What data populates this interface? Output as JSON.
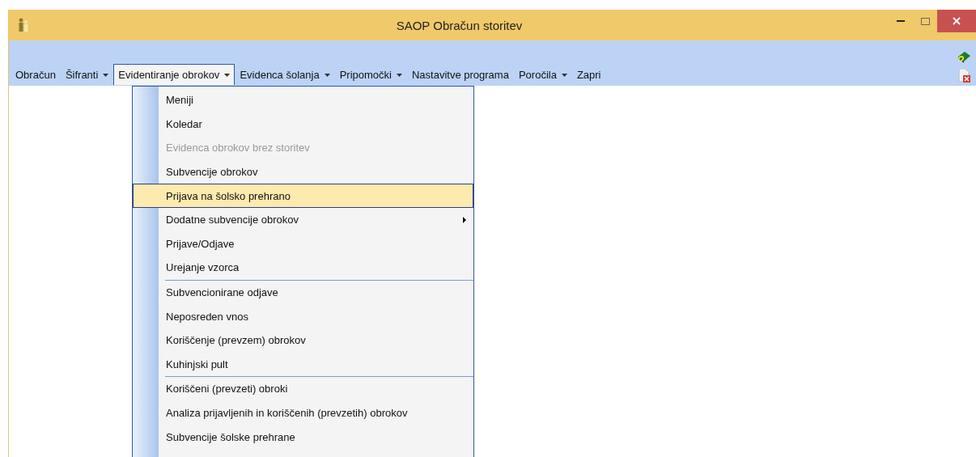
{
  "window": {
    "title": "SAOP Obračun storitev"
  },
  "menubar": [
    {
      "label": "Obračun",
      "dropdown": false,
      "selected": false
    },
    {
      "label": "Šifranti",
      "dropdown": true,
      "selected": false
    },
    {
      "label": "Evidentiranje obrokov",
      "dropdown": true,
      "selected": true
    },
    {
      "label": "Evidenca šolanja",
      "dropdown": true,
      "selected": false
    },
    {
      "label": "Pripomočki",
      "dropdown": true,
      "selected": false
    },
    {
      "label": "Nastavitve programa",
      "dropdown": false,
      "selected": false
    },
    {
      "label": "Poročila",
      "dropdown": true,
      "selected": false
    },
    {
      "label": "Zapri",
      "dropdown": false,
      "selected": false
    }
  ],
  "menu": {
    "groups": [
      [
        {
          "label": "Meniji",
          "disabled": false,
          "selected": false,
          "submenu": false
        },
        {
          "label": "Koledar",
          "disabled": false,
          "selected": false,
          "submenu": false
        },
        {
          "label": "Evidenca obrokov brez storitev",
          "disabled": true,
          "selected": false,
          "submenu": false
        },
        {
          "label": "Subvencije obrokov",
          "disabled": false,
          "selected": false,
          "submenu": false
        },
        {
          "label": "Prijava na šolsko prehrano",
          "disabled": false,
          "selected": true,
          "submenu": false
        },
        {
          "label": "Dodatne subvencije obrokov",
          "disabled": false,
          "selected": false,
          "submenu": true
        },
        {
          "label": "Prijave/Odjave",
          "disabled": false,
          "selected": false,
          "submenu": false
        },
        {
          "label": "Urejanje vzorca",
          "disabled": false,
          "selected": false,
          "submenu": false
        }
      ],
      [
        {
          "label": "Subvencionirane odjave",
          "disabled": false,
          "selected": false,
          "submenu": false
        },
        {
          "label": "Neposreden vnos",
          "disabled": false,
          "selected": false,
          "submenu": false
        },
        {
          "label": "Koriščenje (prevzem) obrokov",
          "disabled": false,
          "selected": false,
          "submenu": false
        },
        {
          "label": "Kuhinjski pult",
          "disabled": false,
          "selected": false,
          "submenu": false
        }
      ],
      [
        {
          "label": "Koriščeni (prevzeti) obroki",
          "disabled": false,
          "selected": false,
          "submenu": false
        },
        {
          "label": "Analiza prijavljenih in koriščenih (prevzetih) obrokov",
          "disabled": false,
          "selected": false,
          "submenu": false
        },
        {
          "label": "Subvencije šolske prehrane",
          "disabled": false,
          "selected": false,
          "submenu": false
        }
      ]
    ]
  }
}
